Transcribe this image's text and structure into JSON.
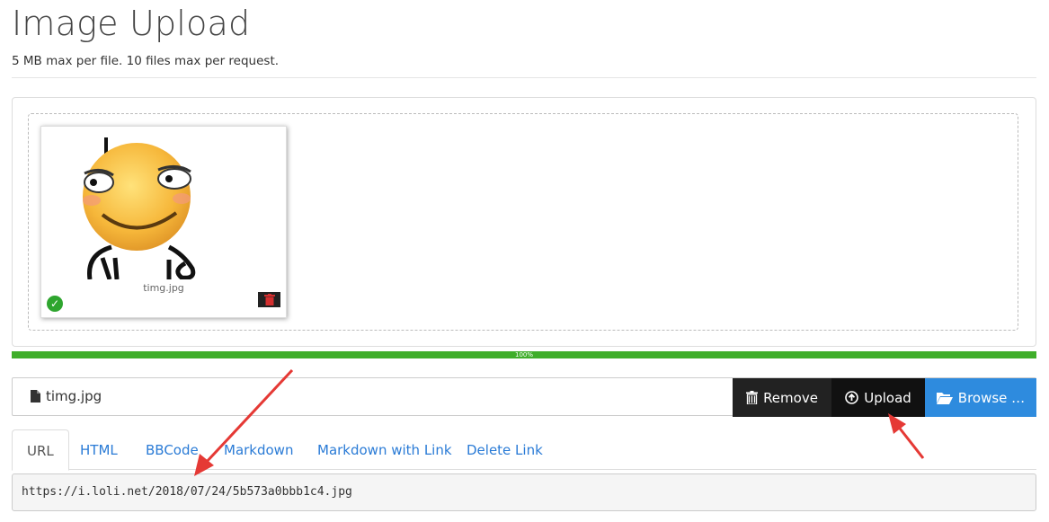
{
  "header": {
    "title": "Image Upload",
    "subtitle": "5 MB max per file. 10 files max per request."
  },
  "preview": {
    "file_name": "timg.jpg",
    "status_icon": "check-circle-icon",
    "delete_icon": "trash-icon"
  },
  "progress": {
    "value": 1.0,
    "label": "100%",
    "color": "#3fae2a"
  },
  "file_input": {
    "caption": "timg.jpg",
    "file_icon": "file-icon",
    "remove_label": "Remove",
    "upload_label": "Upload",
    "browse_label": "Browse …"
  },
  "tabs": [
    {
      "label": "URL",
      "active": true
    },
    {
      "label": "HTML",
      "active": false
    },
    {
      "label": "BBCode",
      "active": false
    },
    {
      "label": "Markdown",
      "active": false
    },
    {
      "label": "Markdown with Link",
      "active": false
    },
    {
      "label": "Delete Link",
      "active": false
    }
  ],
  "output": {
    "url": "https://i.loli.net/2018/07/24/5b573a0bbb1c4.jpg"
  },
  "colors": {
    "accent": "#2e8bde",
    "annotation_arrow": "#e53935"
  }
}
